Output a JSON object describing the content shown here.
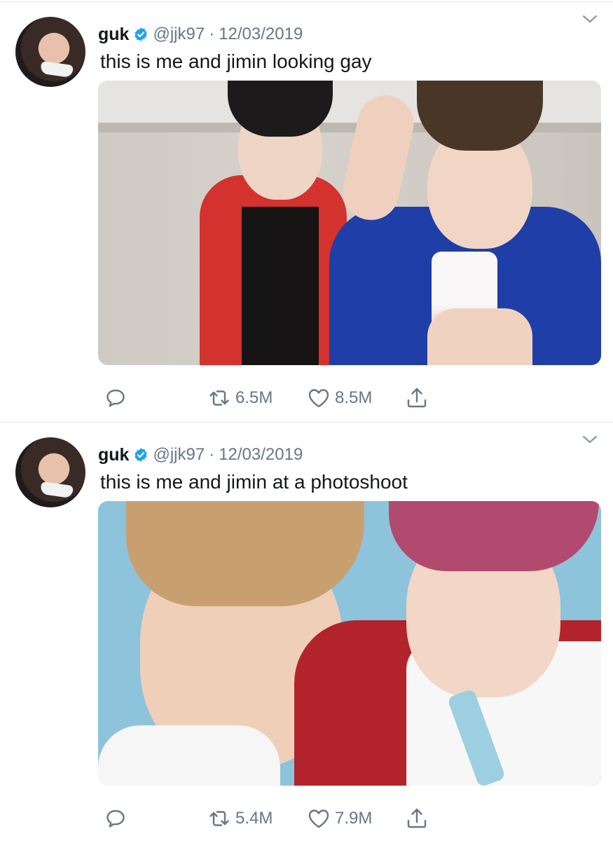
{
  "tweets": [
    {
      "name": "guk",
      "handle": "@jjk97",
      "date": "12/03/2019",
      "text": "this is me and jimin looking gay",
      "retweets": "6.5M",
      "likes": "8.5M"
    },
    {
      "name": "guk",
      "handle": "@jjk97",
      "date": "12/03/2019",
      "text": "this is me and jimin at a photoshoot",
      "retweets": "5.4M",
      "likes": "7.9M"
    }
  ],
  "colors": {
    "verified": "#1da1f2",
    "secondary_text": "#657786",
    "divider": "#e1e8ed"
  },
  "icons": [
    "verified-badge-icon",
    "chevron-down-icon",
    "reply-icon",
    "retweet-icon",
    "like-icon",
    "share-icon"
  ]
}
